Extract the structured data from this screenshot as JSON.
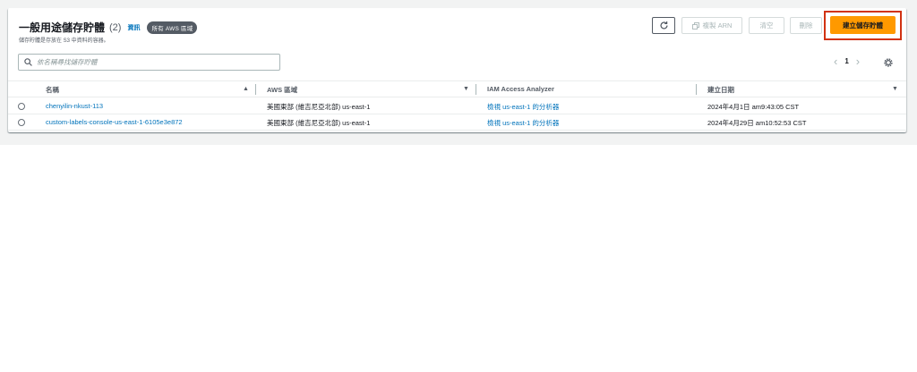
{
  "header": {
    "title": "一般用途儲存貯體",
    "count": "(2)",
    "info_link": "資訊",
    "region_badge": "所有 AWS 區域",
    "subtitle": "儲存貯體是存放在 S3 中資料的容器。"
  },
  "toolbar": {
    "copy_arn_label": "複製 ARN",
    "clear_label": "清空",
    "delete_label": "刪除",
    "create_label": "建立儲存貯體"
  },
  "search": {
    "placeholder": "依名稱尋找儲存貯體"
  },
  "pagination": {
    "current_page": "1"
  },
  "table": {
    "columns": [
      "名稱",
      "AWS 區域",
      "IAM Access Analyzer",
      "建立日期"
    ],
    "rows": [
      {
        "name": "chenyilin-nkust-113",
        "region": "美國東部 (維吉尼亞北部) us-east-1",
        "analyzer": "檢視 us-east-1 的分析器",
        "created": "2024年4月1日 am9:43:05 CST"
      },
      {
        "name": "custom-labels-console-us-east-1-6105e3e872",
        "region": "美國東部 (維吉尼亞北部) us-east-1",
        "analyzer": "檢視 us-east-1 的分析器",
        "created": "2024年4月29日 am10:52:53 CST"
      }
    ]
  },
  "colors": {
    "primary_button": "#ff9900",
    "link": "#0073bb",
    "highlight_box": "#d13212"
  },
  "icons": {
    "refresh": "refresh-icon",
    "copy": "copy-icon",
    "search": "search-icon",
    "settings": "gear-icon",
    "prev": "chevron-left-icon",
    "next": "chevron-right-icon",
    "sort": "sort-ascending-icon"
  }
}
